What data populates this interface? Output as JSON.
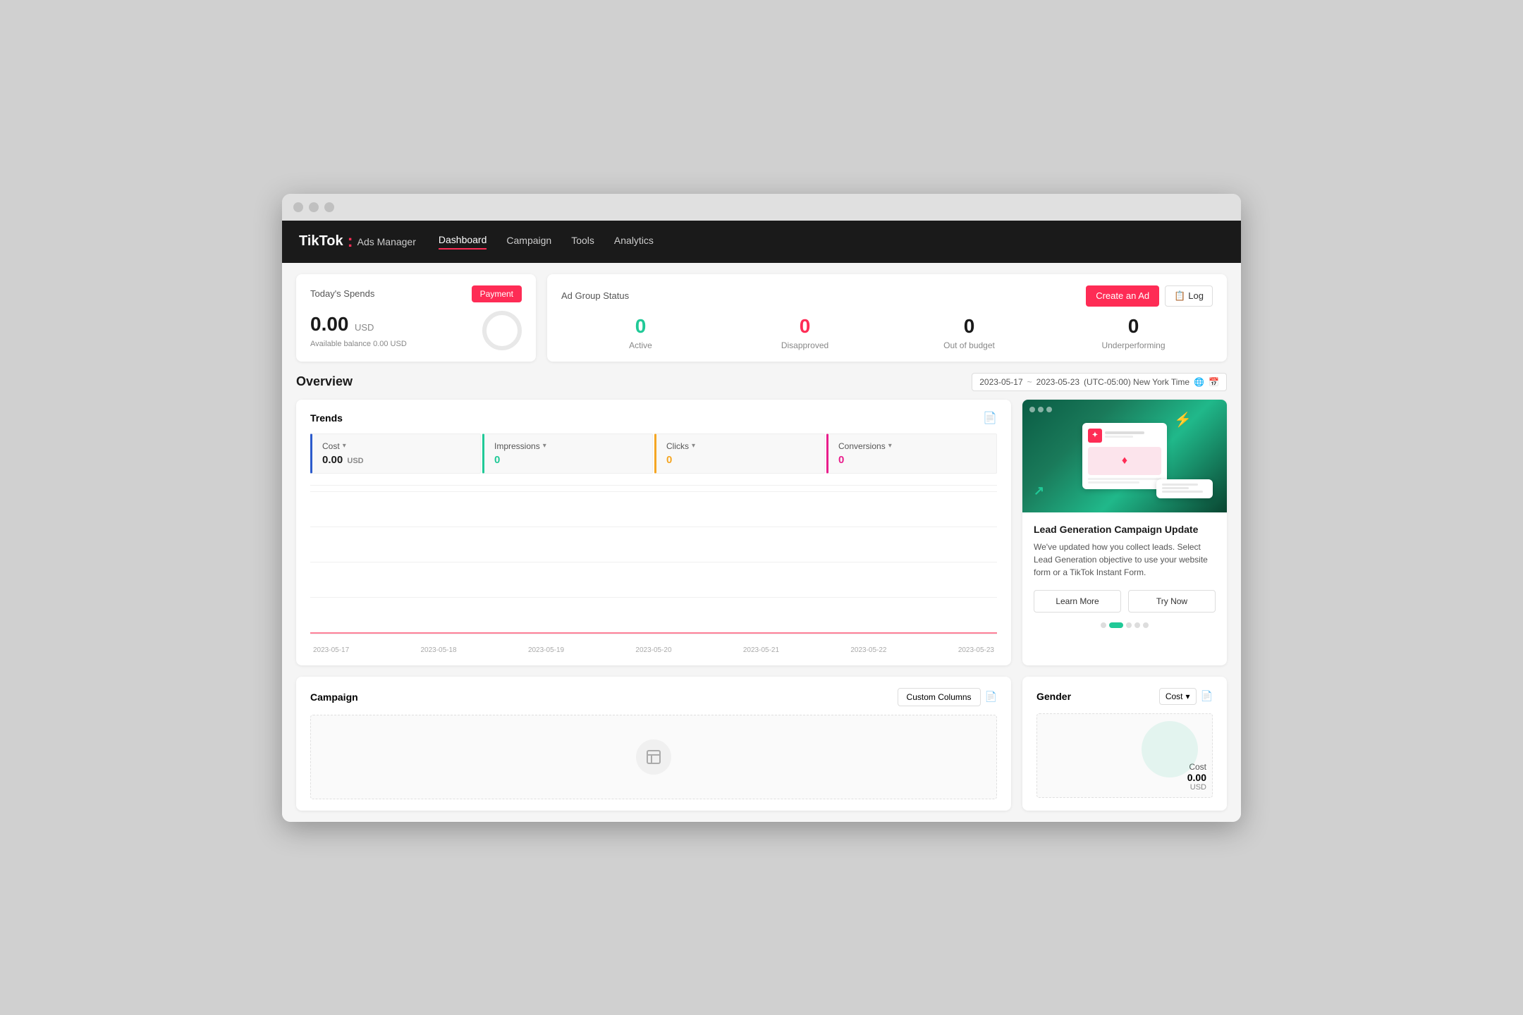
{
  "window": {
    "title": "TikTok Ads Manager"
  },
  "navbar": {
    "brand": "TikTok",
    "brand_dot": ":",
    "subtitle": "Ads Manager",
    "items": [
      {
        "label": "Dashboard",
        "active": true
      },
      {
        "label": "Campaign",
        "active": false
      },
      {
        "label": "Tools",
        "active": false
      },
      {
        "label": "Analytics",
        "active": false
      }
    ]
  },
  "spends": {
    "title": "Today's Spends",
    "payment_label": "Payment",
    "amount": "0.00",
    "currency": "USD",
    "balance": "Available balance 0.00 USD"
  },
  "ad_group": {
    "title": "Ad Group Status",
    "create_ad_label": "Create an Ad",
    "log_label": "Log",
    "statuses": [
      {
        "label": "Active",
        "value": "0",
        "color": "active-color"
      },
      {
        "label": "Disapproved",
        "value": "0",
        "color": "disapproved-color"
      },
      {
        "label": "Out of budget",
        "value": "0",
        "color": "budget-color"
      },
      {
        "label": "Underperforming",
        "value": "0",
        "color": "under-color"
      }
    ]
  },
  "overview": {
    "title": "Overview",
    "date_start": "2023-05-17",
    "date_separator": "~",
    "date_end": "2023-05-23",
    "timezone": "(UTC-05:00) New York Time"
  },
  "trends": {
    "title": "Trends",
    "metrics": [
      {
        "label": "Cost",
        "value": "0.00",
        "unit": "USD",
        "color": "normal"
      },
      {
        "label": "Impressions",
        "value": "0",
        "unit": "",
        "color": "teal"
      },
      {
        "label": "Clicks",
        "value": "0",
        "unit": "",
        "color": "orange"
      },
      {
        "label": "Conversions",
        "value": "0",
        "unit": "",
        "color": "pink"
      }
    ],
    "x_labels": [
      "2023-05-17",
      "2023-05-18",
      "2023-05-19",
      "2023-05-20",
      "2023-05-21",
      "2023-05-22",
      "2023-05-23"
    ]
  },
  "news": {
    "title": "Lead Generation Campaign Update",
    "description": "We've updated how you collect leads. Select Lead Generation objective to use your website form or a TikTok Instant Form.",
    "learn_more_label": "Learn More",
    "try_now_label": "Try Now"
  },
  "campaign": {
    "title": "Campaign",
    "custom_columns_label": "Custom Columns"
  },
  "gender": {
    "title": "Gender",
    "cost_label": "Cost",
    "cost_value": "0.00",
    "cost_currency": "USD",
    "dropdown_arrow": "▾"
  }
}
